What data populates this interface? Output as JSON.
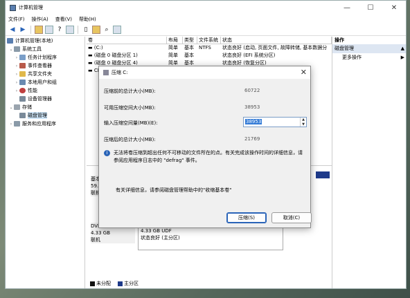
{
  "window": {
    "title": "计算机管理",
    "controls": [
      "—",
      "☐",
      "✕"
    ]
  },
  "menu": [
    "文件(F)",
    "操作(A)",
    "查看(V)",
    "帮助(H)"
  ],
  "tree": {
    "root": "计算机管理(本地)",
    "system_tools": "系统工具",
    "task_scheduler": "任务计划程序",
    "event_viewer": "事件查看器",
    "shared_folders": "共享文件夹",
    "local_users": "本地用户和组",
    "performance": "性能",
    "device_manager": "设备管理器",
    "storage": "存储",
    "disk_management": "磁盘管理",
    "services": "服务和应用程序"
  },
  "volume_list": {
    "headers": [
      "卷",
      "布局",
      "类型",
      "文件系统",
      "状态"
    ],
    "rows": [
      [
        "(C:)",
        "简单",
        "基本",
        "NTFS",
        "状态良好 (启动, 页面文件, 故障转储, 基本数据分"
      ],
      [
        "(磁盘 0 磁盘分区 1)",
        "简单",
        "基本",
        "",
        "状态良好 (EFI 系统分区)"
      ],
      [
        "(磁盘 0 磁盘分区 4)",
        "简单",
        "基本",
        "",
        "状态良好 (恢复分区)"
      ],
      [
        "CP",
        "",
        "",
        "",
        ""
      ]
    ]
  },
  "disks": {
    "disk0": {
      "l1": "基本",
      "l2": "59.9",
      "l3": "联机"
    },
    "dvd": {
      "l1": "DVD",
      "l2": "4.33 GB",
      "l3": "联机"
    },
    "dvd_part": {
      "l1": "4.33 GB UDF",
      "l2": "状态良好 (主分区)"
    }
  },
  "legend": [
    "未分配",
    "主分区"
  ],
  "actions": {
    "header": "操作",
    "selected": "磁盘管理",
    "more": "更多操作"
  },
  "dialog": {
    "title": "压缩 C:",
    "total_before_label": "压缩前的总计大小(MB):",
    "total_before_value": "60722",
    "available_label": "可用压缩空间大小(MB):",
    "available_value": "38953",
    "input_label": "输入压缩空间量(MB)(E):",
    "input_value": "38953",
    "total_after_label": "压缩后的总计大小(MB):",
    "total_after_value": "21769",
    "info_text": "无法将卷压缩到超出任何不可移动的文件所在的点。有关完成该操作时间的详细信息，请参阅应用程序日志中的 \"defrag\" 事件。",
    "help_text": "有关详细信息，请参阅磁盘管理帮助中的\"收缩基本卷\"",
    "shrink_button": "压缩(S)",
    "cancel_button": "取消(C)"
  }
}
